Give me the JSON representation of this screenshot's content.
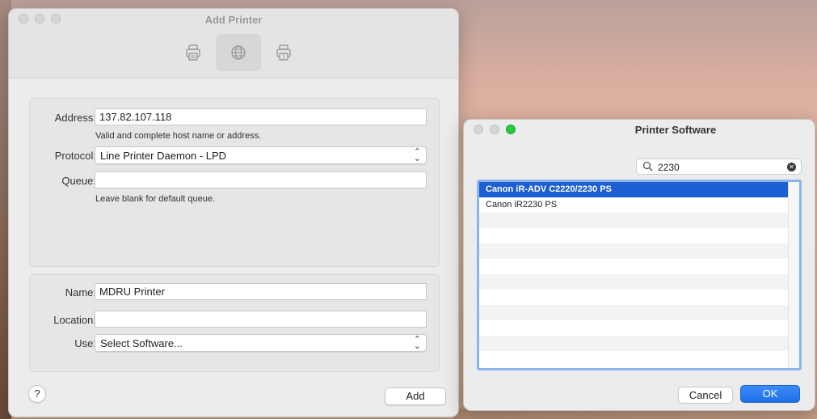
{
  "add_printer": {
    "title": "Add Printer",
    "toolbar": [
      {
        "icon": "printer-default-icon",
        "selected": false
      },
      {
        "icon": "globe-ip-icon",
        "selected": true
      },
      {
        "icon": "printer-windows-icon",
        "selected": false
      }
    ],
    "address_label": "Address:",
    "address_value": "137.82.107.118",
    "address_hint": "Valid and complete host name or address.",
    "protocol_label": "Protocol:",
    "protocol_value": "Line Printer Daemon - LPD",
    "queue_label": "Queue:",
    "queue_value": "",
    "queue_hint": "Leave blank for default queue.",
    "name_label": "Name:",
    "name_value": "MDRU Printer",
    "location_label": "Location:",
    "location_value": "",
    "use_label": "Use:",
    "use_value": "Select Software...",
    "help_label": "?",
    "add_label": "Add"
  },
  "printer_software": {
    "title": "Printer Software",
    "search_value": "2230",
    "results": [
      {
        "label": "Canon iR-ADV C2220/2230 PS",
        "selected": true
      },
      {
        "label": "Canon iR2230 PS",
        "selected": false
      }
    ],
    "cancel_label": "Cancel",
    "ok_label": "OK"
  },
  "colors": {
    "accent": "#1c5fd4",
    "ok_button": "#2f7df5",
    "list_focus_ring": "#8db3ec"
  }
}
